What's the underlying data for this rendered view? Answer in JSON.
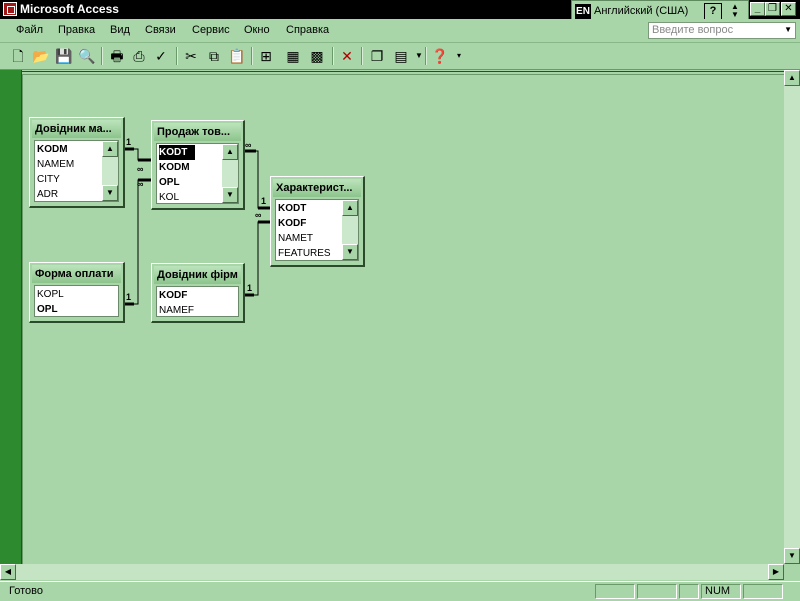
{
  "window": {
    "title": "Microsoft Access"
  },
  "language_bar": {
    "code": "EN",
    "name": "Английский (США)",
    "help": "?"
  },
  "menu": {
    "items": [
      {
        "label": "Файл"
      },
      {
        "label": "Правка"
      },
      {
        "label": "Вид"
      },
      {
        "label": "Связи"
      },
      {
        "label": "Сервис"
      },
      {
        "label": "Окно"
      },
      {
        "label": "Справка"
      }
    ]
  },
  "help_search": {
    "placeholder": "Введите вопрос"
  },
  "tables": {
    "dovidnyk_mag": {
      "title": "Довідник ма...",
      "fields": [
        "KODM",
        "NAMEM",
        "CITY",
        "ADR"
      ]
    },
    "prodazh": {
      "title": "Продаж тов...",
      "fields": [
        "KODT",
        "KODM",
        "OPL",
        "KOL"
      ]
    },
    "kharakt": {
      "title": "Характерист...",
      "fields": [
        "KODT",
        "KODF",
        "NAMET",
        "FEATURES"
      ]
    },
    "forma_oplaty": {
      "title": "Форма оплати",
      "fields": [
        "KOPL",
        "OPL"
      ]
    },
    "dovidnyk_firm": {
      "title": "Довідник фірм",
      "fields": [
        "KODF",
        "NAMEF"
      ]
    }
  },
  "relations": {
    "one": "1",
    "many": "∞"
  },
  "status": {
    "text": "Готово",
    "num": "NUM"
  },
  "colors": {
    "accent": "#a8d6a8",
    "mdi_border": "#2e8a2e",
    "titlebar": "#000000"
  }
}
